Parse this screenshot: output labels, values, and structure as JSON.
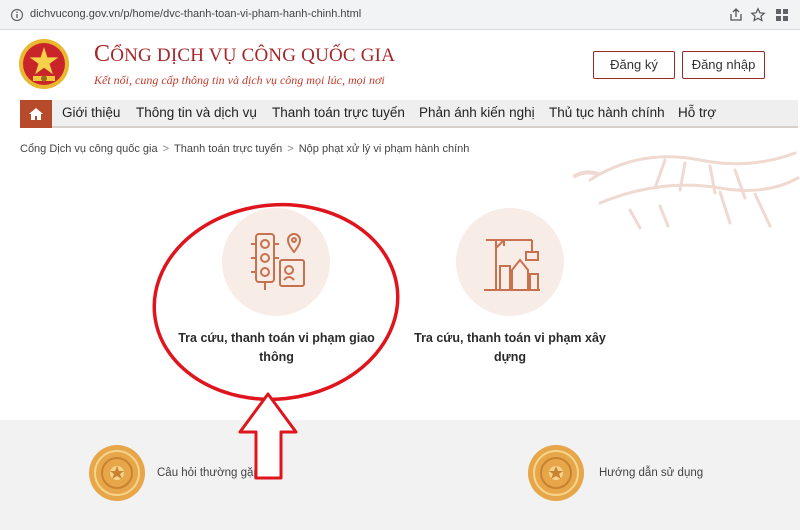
{
  "browser": {
    "url": "dichvucong.gov.vn/p/home/dvc-thanh-toan-vi-pham-hanh-chinh.html"
  },
  "header": {
    "title_cap": "C",
    "title_rest": "ỔNG DỊCH VỤ CÔNG QUỐC GIA",
    "subtitle": "Kết nối, cung cấp thông tin và dịch vụ công mọi lúc, mọi nơi",
    "register_label": "Đăng ký",
    "login_label": "Đăng nhập"
  },
  "nav": {
    "items": [
      {
        "label": "Giới thiệu"
      },
      {
        "label": "Thông tin và dịch vụ"
      },
      {
        "label": "Thanh toán trực tuyến"
      },
      {
        "label": "Phản ánh kiến nghị"
      },
      {
        "label": "Thủ tục hành chính"
      },
      {
        "label": "Hỗ trợ"
      }
    ]
  },
  "breadcrumb": {
    "items": [
      {
        "label": "Cổng Dịch vụ công quốc gia"
      },
      {
        "label": "Thanh toán trực tuyến"
      },
      {
        "label": "Nộp phạt xử lý vi phạm hành chính"
      }
    ],
    "separator": ">"
  },
  "cards": [
    {
      "line1": "Tra cứu, thanh toán vi phạm giao",
      "line2": "thông",
      "icon": "traffic-light-icon"
    },
    {
      "line1": "Tra cứu, thanh toán vi phạm xây",
      "line2": "dựng",
      "icon": "construction-crane-icon"
    }
  ],
  "footer": {
    "faq_label": "Câu hỏi thường gặp",
    "guide_label": "Hướng dẫn sử dụng"
  },
  "colors": {
    "brand_red": "#a7262a",
    "nav_home": "#b74a2a",
    "annotation_red": "#e0141c",
    "card_bg": "#f8ece7",
    "icon_stroke": "#c8714f"
  }
}
